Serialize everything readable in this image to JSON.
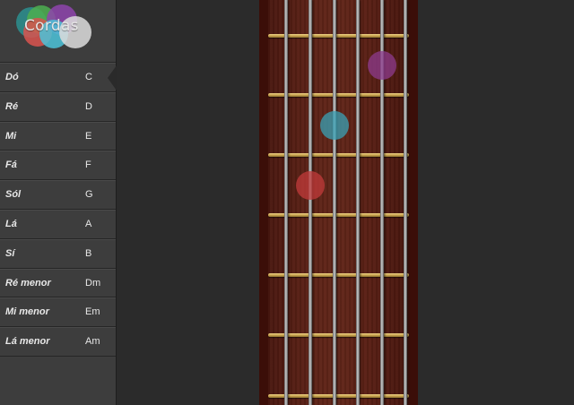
{
  "app": {
    "logo_text": "Cordas"
  },
  "colors": {
    "marker_1": "#c13b3b",
    "marker_2": "#3aa2b6",
    "marker_3": "#8e3b8e",
    "logo_bubbles": [
      "#2c8f8f",
      "#4caf50",
      "#d9534f",
      "#8e44ad",
      "#4cc3d9",
      "#dddddd"
    ]
  },
  "chords": [
    {
      "name": "Dó",
      "symbol": "C",
      "selected": true
    },
    {
      "name": "Ré",
      "symbol": "D",
      "selected": false
    },
    {
      "name": "Mi",
      "symbol": "E",
      "selected": false
    },
    {
      "name": "Fá",
      "symbol": "F",
      "selected": false
    },
    {
      "name": "Sól",
      "symbol": "G",
      "selected": false
    },
    {
      "name": "Lá",
      "symbol": "A",
      "selected": false
    },
    {
      "name": "Sí",
      "symbol": "B",
      "selected": false
    },
    {
      "name": "Ré menor",
      "symbol": "Dm",
      "selected": false
    },
    {
      "name": "Mi menor",
      "symbol": "Em",
      "selected": false
    },
    {
      "name": "Lá menor",
      "symbol": "Am",
      "selected": false
    }
  ],
  "fretboard": {
    "string_count": 6,
    "fret_count": 7,
    "finger_positions": [
      {
        "string": 2,
        "fret": 3,
        "color": "#c13b3b"
      },
      {
        "string": 3,
        "fret": 2,
        "color": "#3aa2b6"
      },
      {
        "string": 5,
        "fret": 1,
        "color": "#8e3b8e"
      }
    ]
  }
}
